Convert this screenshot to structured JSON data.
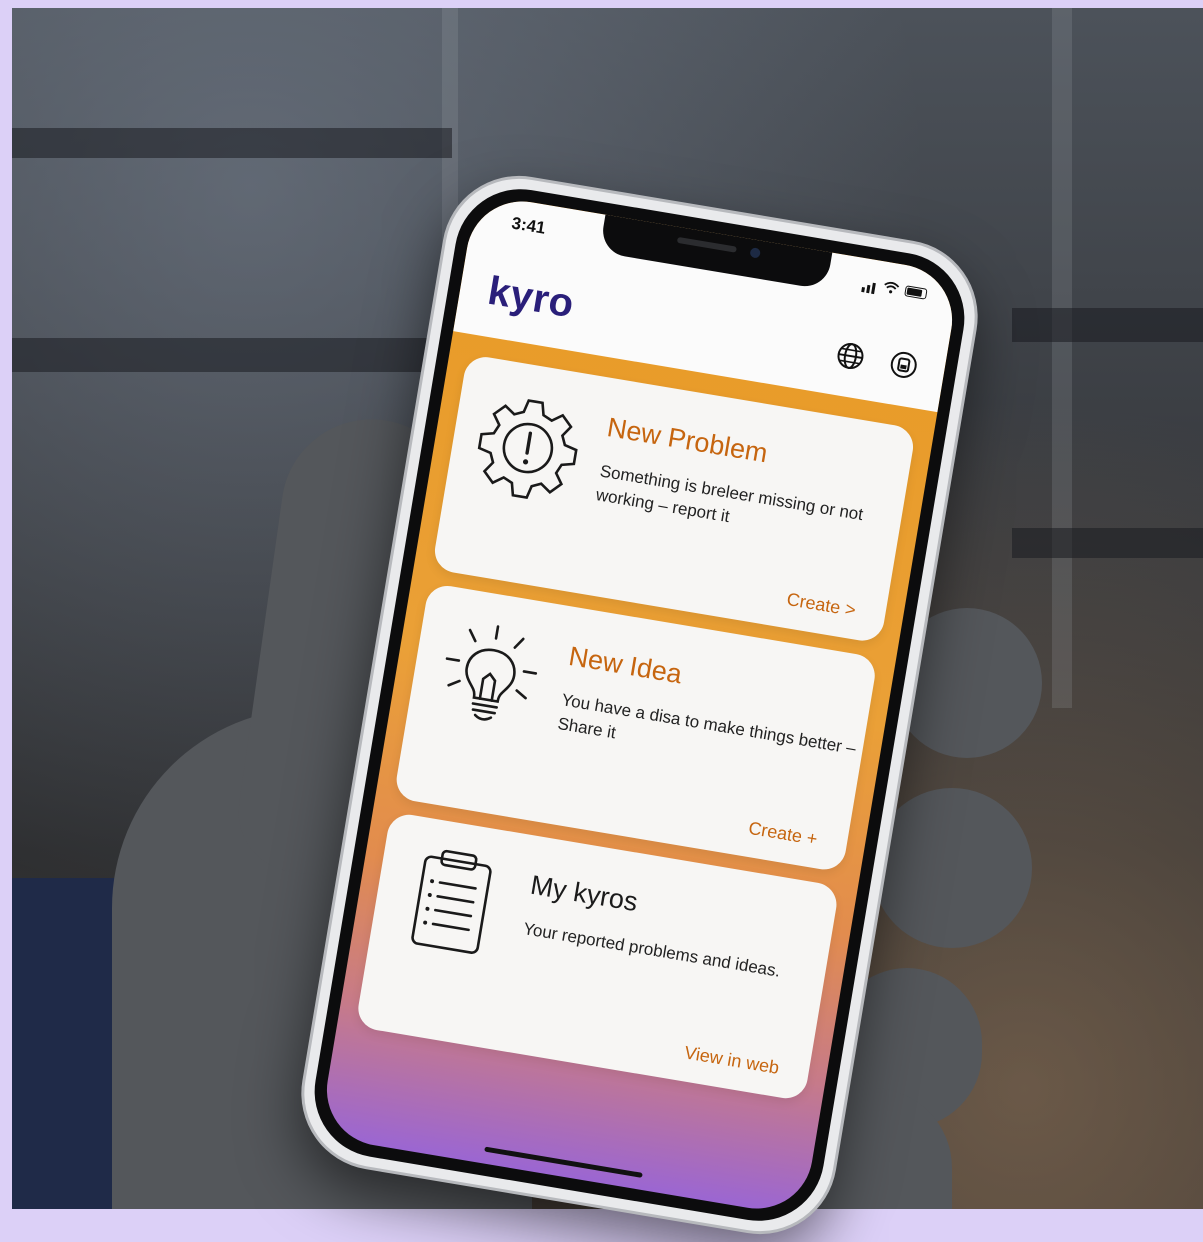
{
  "status_bar": {
    "time": "3:41"
  },
  "app": {
    "logo": "kyro"
  },
  "header_icons": [
    "globe-icon",
    "settings-icon"
  ],
  "cards": [
    {
      "icon": "gear-alert-icon",
      "title": "New Problem",
      "description": "Something is breleer missing or not working – report it",
      "action": "Create >"
    },
    {
      "icon": "lightbulb-icon",
      "title": "New Idea",
      "description": "You have a disa to make things better – Share it",
      "action": "Create +"
    },
    {
      "icon": "clipboard-icon",
      "title": "My kyros",
      "description": "Your reported problems and ideas.",
      "action": "View in web"
    }
  ],
  "colors": {
    "brand": "#2a1f7a",
    "accent": "#c6650f",
    "gradient_top": "#e89a24",
    "gradient_bottom": "#9b66d2"
  }
}
